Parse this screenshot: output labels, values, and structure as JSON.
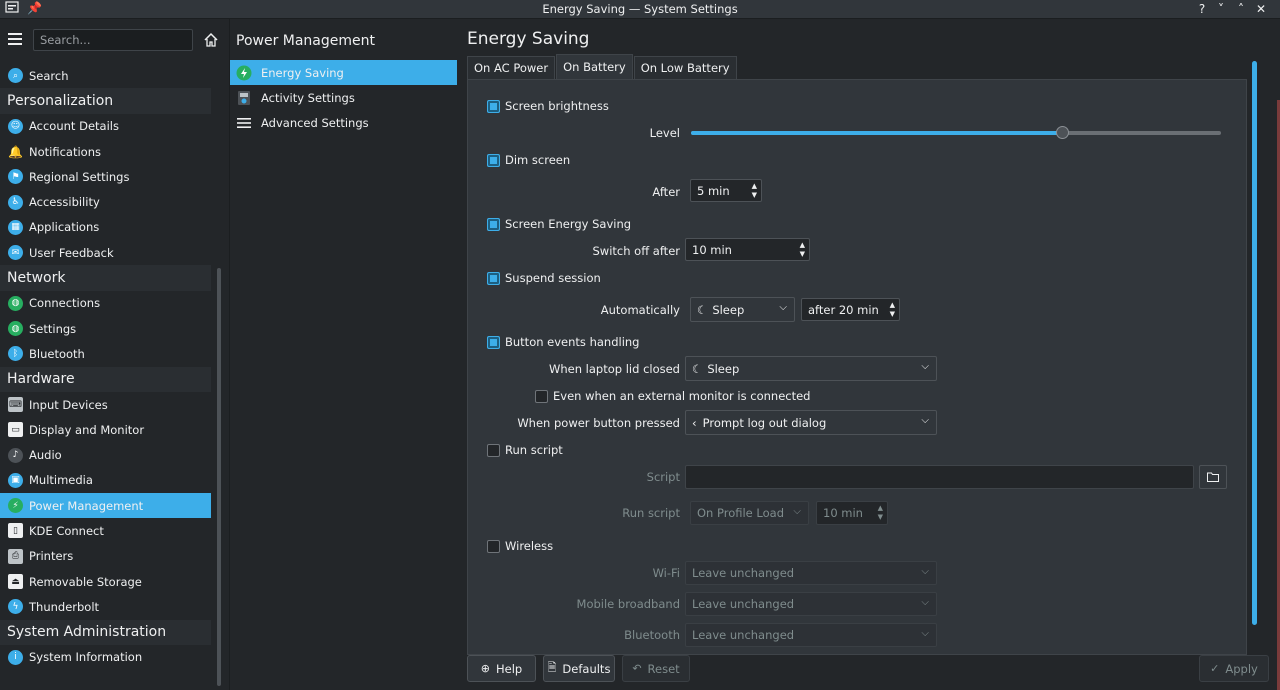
{
  "window": {
    "title": "Energy Saving — System Settings",
    "controls": [
      "?",
      "˅",
      "˄",
      "✕"
    ]
  },
  "sidebar": {
    "search_placeholder": "Search...",
    "items": [
      {
        "type": "item",
        "label": "Search",
        "icon": "search-icon",
        "color": "#3daee9"
      },
      {
        "type": "category",
        "label": "Personalization"
      },
      {
        "type": "item",
        "label": "Account Details",
        "icon": "user-icon",
        "color": "#3daee9"
      },
      {
        "type": "item",
        "label": "Notifications",
        "icon": "bell-icon",
        "color": "#f6a623"
      },
      {
        "type": "item",
        "label": "Regional Settings",
        "icon": "flag-icon",
        "color": "#3daee9"
      },
      {
        "type": "item",
        "label": "Accessibility",
        "icon": "accessibility-icon",
        "color": "#3daee9"
      },
      {
        "type": "item",
        "label": "Applications",
        "icon": "grid-icon",
        "color": "#3daee9"
      },
      {
        "type": "item",
        "label": "User Feedback",
        "icon": "chat-icon",
        "color": "#3daee9"
      },
      {
        "type": "category",
        "label": "Network"
      },
      {
        "type": "item",
        "label": "Connections",
        "icon": "globe-icon",
        "color": "#27ae60"
      },
      {
        "type": "item",
        "label": "Settings",
        "icon": "globe-icon",
        "color": "#27ae60"
      },
      {
        "type": "item",
        "label": "Bluetooth",
        "icon": "bluetooth-icon",
        "color": "#3daee9"
      },
      {
        "type": "category",
        "label": "Hardware"
      },
      {
        "type": "item",
        "label": "Input Devices",
        "icon": "keyboard-icon",
        "color": "#bdc3c7"
      },
      {
        "type": "item",
        "label": "Display and Monitor",
        "icon": "monitor-icon",
        "color": "#eff0f1"
      },
      {
        "type": "item",
        "label": "Audio",
        "icon": "speaker-icon",
        "color": "#4d5257"
      },
      {
        "type": "item",
        "label": "Multimedia",
        "icon": "media-icon",
        "color": "#3daee9"
      },
      {
        "type": "item",
        "label": "Power Management",
        "icon": "power-icon",
        "color": "#27ae60",
        "active": true
      },
      {
        "type": "item",
        "label": "KDE Connect",
        "icon": "phone-icon",
        "color": "#eff0f1"
      },
      {
        "type": "item",
        "label": "Printers",
        "icon": "printer-icon",
        "color": "#bdc3c7"
      },
      {
        "type": "item",
        "label": "Removable Storage",
        "icon": "usb-icon",
        "color": "#eff0f1"
      },
      {
        "type": "item",
        "label": "Thunderbolt",
        "icon": "thunderbolt-icon",
        "color": "#3daee9"
      },
      {
        "type": "category",
        "label": "System Administration"
      },
      {
        "type": "item",
        "label": "System Information",
        "icon": "info-icon",
        "color": "#3daee9"
      }
    ]
  },
  "middle": {
    "title": "Power Management",
    "items": [
      {
        "label": "Energy Saving",
        "icon": "energy-icon",
        "active": true
      },
      {
        "label": "Activity Settings",
        "icon": "activity-icon"
      },
      {
        "label": "Advanced Settings",
        "icon": "menu-icon"
      }
    ]
  },
  "main": {
    "title": "Energy Saving",
    "tabs": [
      {
        "label": "On AC Power"
      },
      {
        "label": "On Battery",
        "active": true
      },
      {
        "label": "On Low Battery"
      }
    ],
    "screen_brightness": {
      "label": "Screen brightness",
      "checked": true,
      "level_label": "Level",
      "level": 0.7
    },
    "dim_screen": {
      "label": "Dim screen",
      "checked": true,
      "after_label": "After",
      "after_value": "5 min"
    },
    "screen_energy": {
      "label": "Screen Energy Saving",
      "checked": true,
      "switch_label": "Switch off after",
      "switch_value": "10 min"
    },
    "suspend": {
      "label": "Suspend session",
      "checked": true,
      "auto_label": "Automatically",
      "action": "Sleep",
      "after_value": "after 20 min"
    },
    "buttons": {
      "label": "Button events handling",
      "checked": true,
      "lid_label": "When laptop lid closed",
      "lid_value": "Sleep",
      "external_label": "Even when an external monitor is connected",
      "external_checked": false,
      "power_label": "When power button pressed",
      "power_value": "Prompt log out dialog"
    },
    "run_script": {
      "label": "Run script",
      "checked": false,
      "script_label": "Script",
      "script_value": "",
      "run_label": "Run script",
      "run_value": "On Profile Load",
      "time_value": "10 min"
    },
    "wireless": {
      "label": "Wireless",
      "checked": false,
      "wifi_label": "Wi-Fi",
      "wifi_value": "Leave unchanged",
      "mobile_label": "Mobile broadband",
      "mobile_value": "Leave unchanged",
      "bt_label": "Bluetooth",
      "bt_value": "Leave unchanged"
    }
  },
  "footer": {
    "help": "Help",
    "defaults": "Defaults",
    "reset": "Reset",
    "apply": "Apply"
  },
  "colors": {
    "accent": "#3daee9",
    "bg": "#232629",
    "panel": "#31363b",
    "text": "#eff0f1",
    "disabled": "#7f8c8d"
  }
}
